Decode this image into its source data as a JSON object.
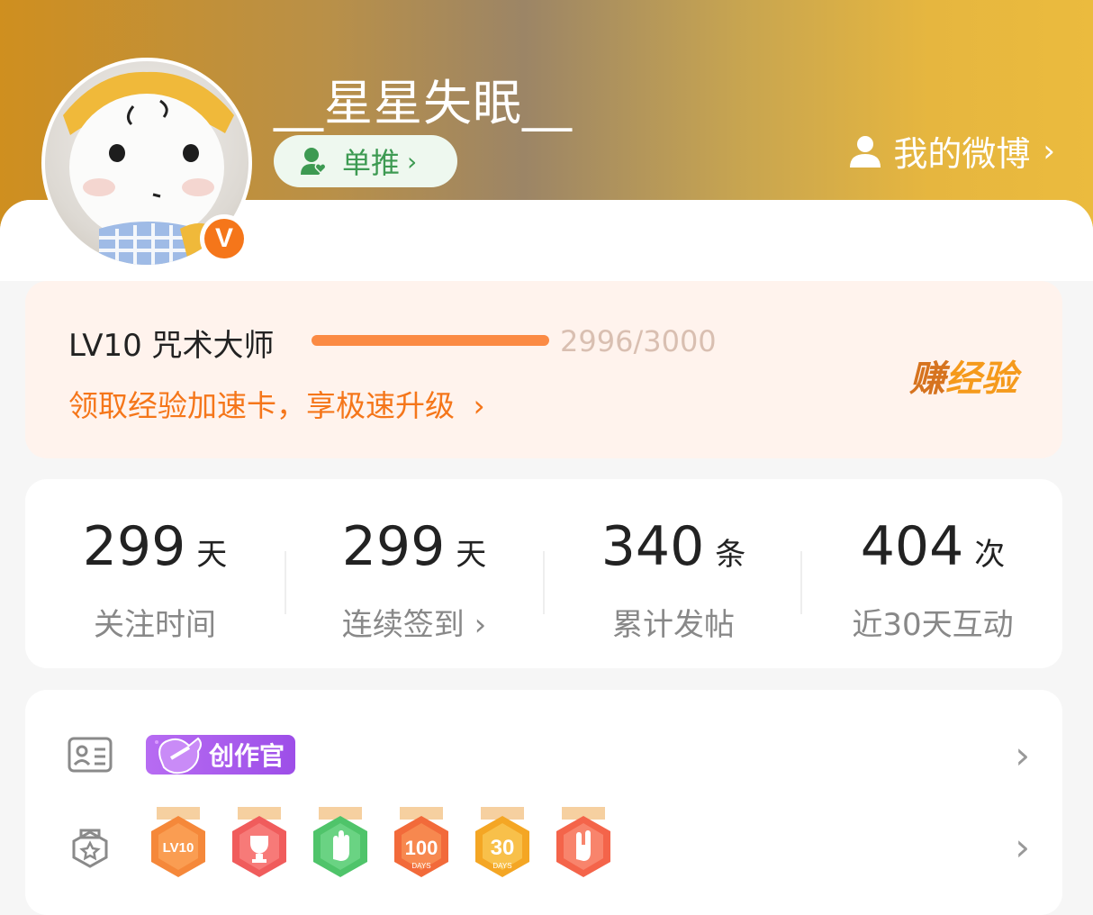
{
  "header": {
    "username": "__星星失眠__",
    "tag_label": "单推",
    "my_weibo_label": "我的微博"
  },
  "level": {
    "title": "LV10 咒术大师",
    "progress_text": "2996/3000",
    "progress_fraction": 0.9987,
    "link_text": "领取经验加速卡，享极速升级",
    "earn_label_1": "赚",
    "earn_label_2": "经验"
  },
  "stats": [
    {
      "value": "299",
      "unit": "天",
      "label": "关注时间"
    },
    {
      "value": "299",
      "unit": "天",
      "label": "连续签到 ›"
    },
    {
      "value": "340",
      "unit": "条",
      "label": "累计发帖"
    },
    {
      "value": "404",
      "unit": "次",
      "label": "近30天互动"
    }
  ],
  "badges": {
    "creator_label": "创作官",
    "medals": [
      {
        "icon": "lv10-medal-icon",
        "text": "LV10"
      },
      {
        "icon": "trophy-medal-icon",
        "text": ""
      },
      {
        "icon": "hand-medal-icon",
        "text": ""
      },
      {
        "icon": "100-days-medal-icon",
        "text": "100"
      },
      {
        "icon": "30-days-medal-icon",
        "text": "30"
      },
      {
        "icon": "rock-hand-medal-icon",
        "text": ""
      }
    ]
  },
  "colors": {
    "accent": "#f5761a",
    "green": "#3d9a52",
    "purple": "#9d4ee8"
  }
}
